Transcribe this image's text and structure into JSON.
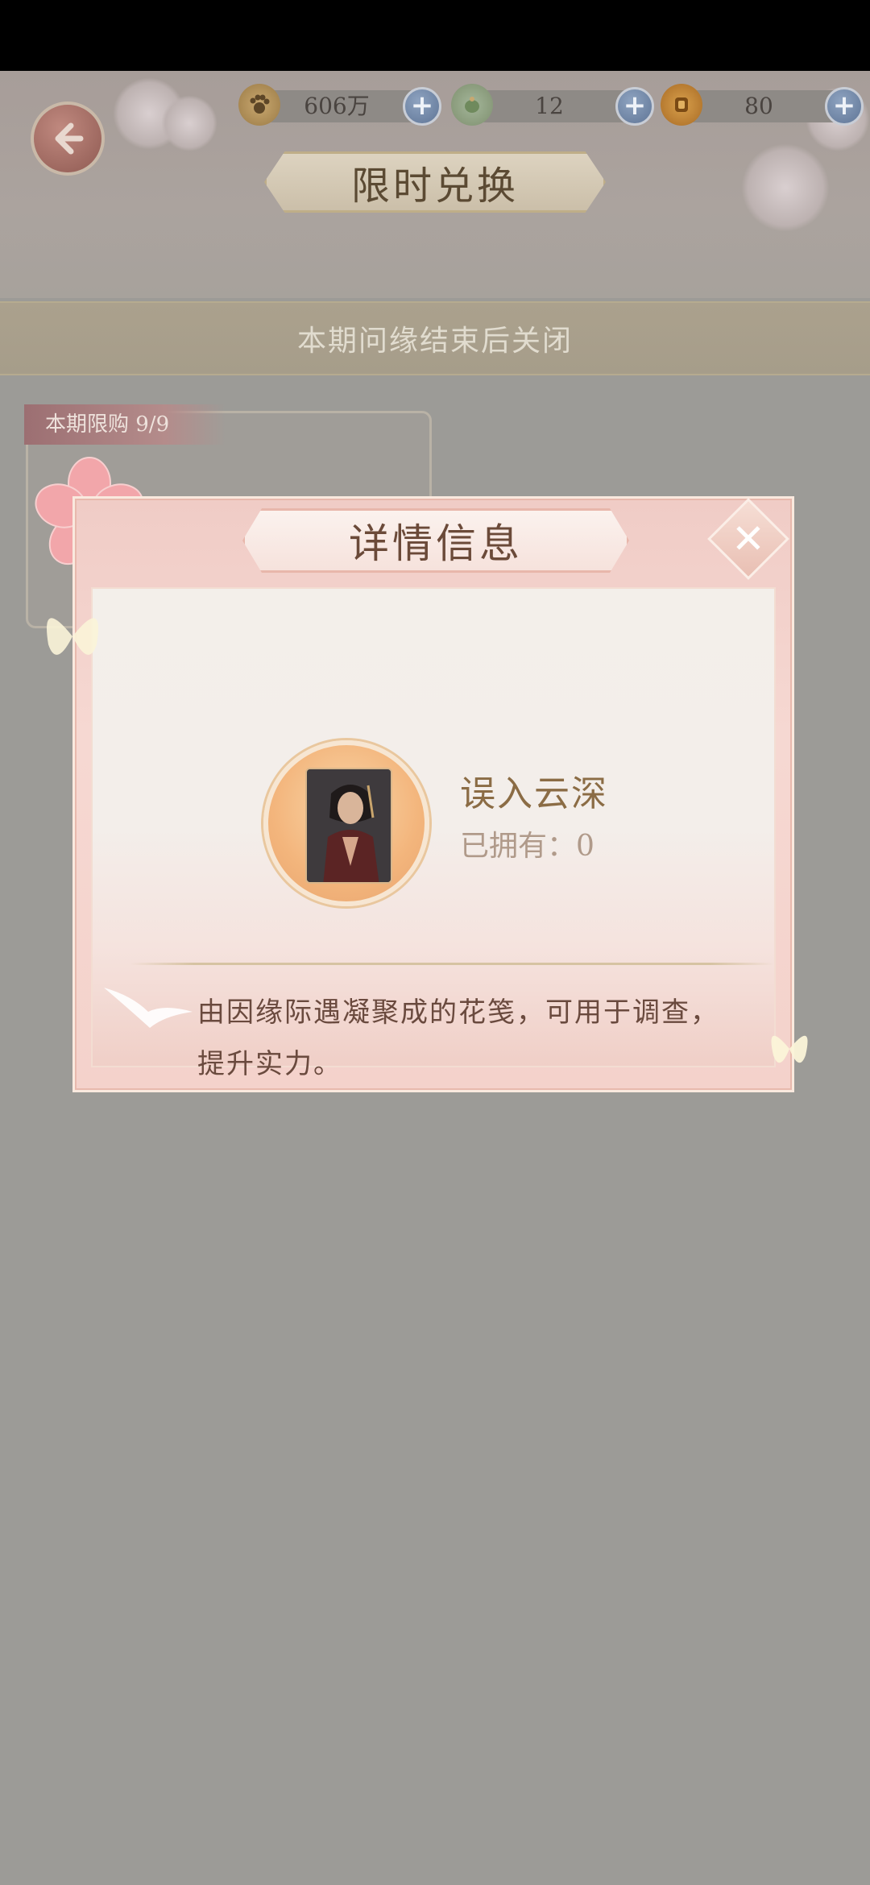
{
  "header": {
    "title": "限时兑换",
    "currencies": [
      {
        "icon": "paw-coin-icon",
        "value": "606万"
      },
      {
        "icon": "jade-icon",
        "value": "12"
      },
      {
        "icon": "gold-token-icon",
        "value": "80"
      }
    ]
  },
  "notice": "本期问缘结束后关闭",
  "shop_item": {
    "limit_label": "本期限购 9/9"
  },
  "modal": {
    "title": "详情信息",
    "close_symbol": "✕",
    "item_name": "误入云深",
    "owned_label": "已拥有：",
    "owned_count": "0",
    "description": "由因缘际遇凝聚成的花笺，可用于调查，提升实力。"
  },
  "colors": {
    "accent_pink": "#f0ccc6",
    "title_text": "#6b4a39",
    "item_name": "#8b6c45",
    "overlay_gray": "#9c9b97"
  }
}
